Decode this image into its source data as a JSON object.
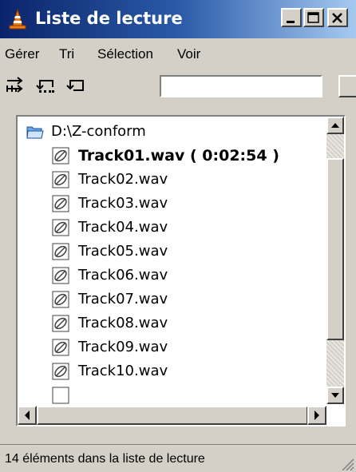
{
  "window": {
    "title": "Liste de lecture",
    "icon": "vlc-cone-icon"
  },
  "menu": {
    "items": [
      "Gérer",
      "Tri",
      "Sélection",
      "Voir"
    ]
  },
  "toolbar": {
    "tools": [
      "shuffle-icon",
      "repeat-all-icon",
      "repeat-one-icon"
    ],
    "search_value": ""
  },
  "playlist": {
    "folder": "D:\\Z-conform",
    "items": [
      "Track01.wav ( 0:02:54 )",
      "Track02.wav",
      "Track03.wav",
      "Track04.wav",
      "Track05.wav",
      "Track06.wav",
      "Track07.wav",
      "Track08.wav",
      "Track09.wav",
      "Track10.wav"
    ],
    "current_index": 0
  },
  "status": {
    "text": "14 éléments dans la liste de lecture"
  }
}
